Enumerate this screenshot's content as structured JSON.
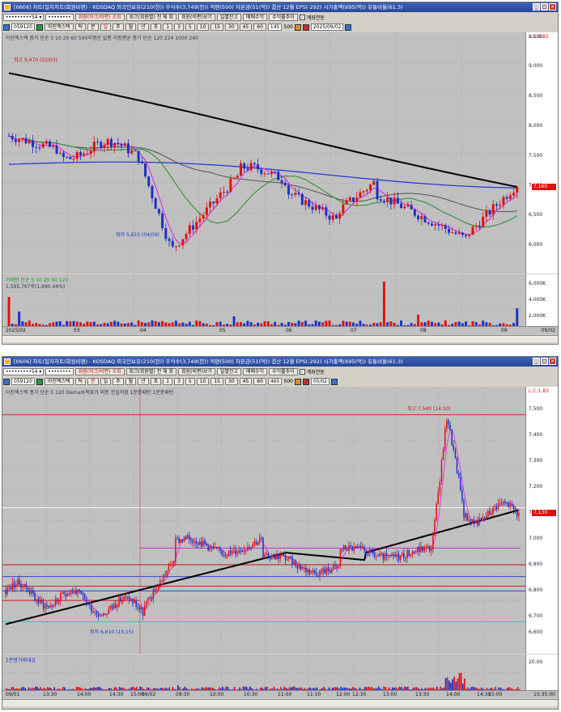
{
  "top": {
    "title": "[0606] 차트(일자차트(회원비편) - KOSDAQ 외국인보유(210(천)) 주식수(3,749(천)) 적편(500) 자본금(51(억)) 결산 12월 EPS(-292) 시가총액(695(억)) 유통비율(61.3)",
    "code": "059120",
    "stock_name": "아진엑스텍",
    "period_buttons": [
      "틱",
      "분",
      "일",
      "주",
      "월",
      "년",
      "초"
    ],
    "minute_buttons": [
      "1",
      "3",
      "5",
      "10",
      "15",
      "30",
      "45",
      "60"
    ],
    "count": "145",
    "total": "500",
    "date": "2025/09/02",
    "buttons": [
      "일별잔고",
      "매매수익",
      "수익률추이"
    ],
    "checkbox_label": "계좌연동",
    "legend": "아진엑스텍  종가 단순 5  10  20  60  500지평선  일봉 이동평균  종가 단순 120  224  1000  240",
    "high_annot": "최고 9,470 (02/03)",
    "low_annot": "최저 5,810 (04/09)",
    "vol_legend": "거래량  단순 5  10  20  60  120",
    "vol_value": "1,595,767주(1,690.44%)",
    "price_ticks": [
      "9,500",
      "9,000",
      "8,500",
      "8,000",
      "7,500",
      "7,000",
      "6,500",
      "6,000"
    ],
    "vol_ticks": [
      "6,000K",
      "4,000K",
      "2,000K"
    ],
    "price_tag": "7,160",
    "top_label": "L:C:8.82",
    "x_labels": [
      "2025/02",
      "03",
      "04",
      "05",
      "06",
      "07",
      "08",
      "09"
    ],
    "x_end": "09/02"
  },
  "bottom": {
    "title": "[0606] 차트(일자차트(회원비편) - KOSDAQ 외국인보유(210(천)) 주식수(3,749(천)) 적편(500) 자본금(51(억)) 결산 12월 EPS(-292) 시가총액(695(억)) 유통비율(61.3)",
    "code": "059120",
    "stock_name": "아진엑스텍",
    "period_buttons": [
      "틱",
      "분",
      "일",
      "주",
      "월",
      "년",
      "초"
    ],
    "minute_buttons": [
      "1",
      "3",
      "5",
      "10",
      "15",
      "30",
      "45",
      "60"
    ],
    "count": "465",
    "total": "500",
    "date": "05/02",
    "buttons": [
      "일별잔고",
      "매매수익",
      "수익률추이"
    ],
    "checkbox_label": "계좌연동",
    "legend": "아진엑스텍  종가 단순 5  120  Demark목표가  피봇  전일저점  1분봉패턴  1분봉패턴",
    "high_annot": "최고 7,540 (14:10)",
    "low_annot": "최저 6,610 (15:15)",
    "vol_legend": "1분봉거래대금",
    "price_ticks": [
      "7,500",
      "7,400",
      "7,300",
      "7,200",
      "7,100",
      "7,000",
      "6,900",
      "6,800",
      "6,700",
      "6,600"
    ],
    "vol_ticks": [
      "20.00"
    ],
    "price_tag": "7,130",
    "top_label": "L:C:1.83",
    "x_labels": [
      "09/01",
      "13:30",
      "14:00",
      "14:30",
      "15:00",
      "09/02",
      "09:30",
      "10:00",
      "10:30",
      "11:00",
      "11:30",
      "12:00",
      "12:30",
      "13:00",
      "13:30",
      "14:00",
      "14:30",
      "15:00"
    ],
    "x_end": "15:35:00"
  },
  "colors": {
    "up": "#e01010",
    "down": "#1a30c8",
    "ma5": "#e020e0",
    "ma120": "#000000",
    "ma20": "#2a8a2a",
    "ma60": "#505050",
    "ma_blue": "#2030d8"
  }
}
